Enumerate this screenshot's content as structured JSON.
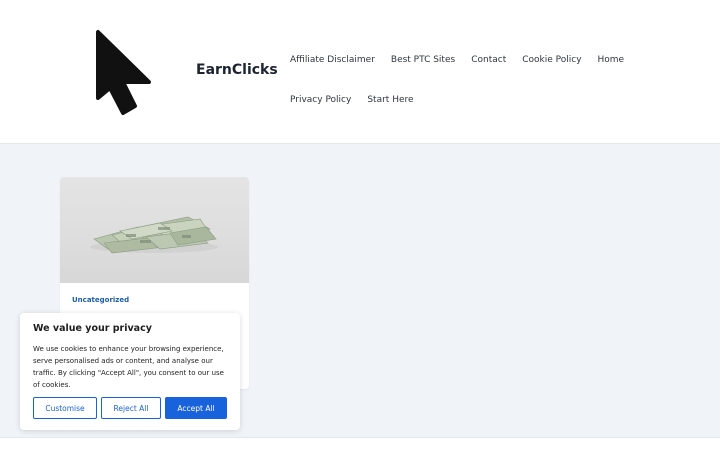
{
  "header": {
    "site_title": "EarnClicks",
    "logo_icon": "cursor-arrow-icon"
  },
  "nav": {
    "row1": [
      "Affiliate Disclaimer",
      "Best PTC Sites",
      "Contact",
      "Cookie Policy",
      "Home"
    ],
    "row2": [
      "Privacy Policy",
      "Start Here"
    ]
  },
  "post": {
    "category": "Uncategorized",
    "thumbnail": "money-stack-image"
  },
  "cookie_banner": {
    "title": "We value your privacy",
    "text": "We use cookies to enhance your browsing experience, serve personalised ads or content, and analyse our traffic. By clicking \"Accept All\", you consent to our use of cookies.",
    "customise_label": "Customise",
    "reject_label": "Reject All",
    "accept_label": "Accept All"
  },
  "colors": {
    "accent": "#1863dc",
    "page_background": "#f0f4f8",
    "category_link": "#1c5fa8"
  }
}
